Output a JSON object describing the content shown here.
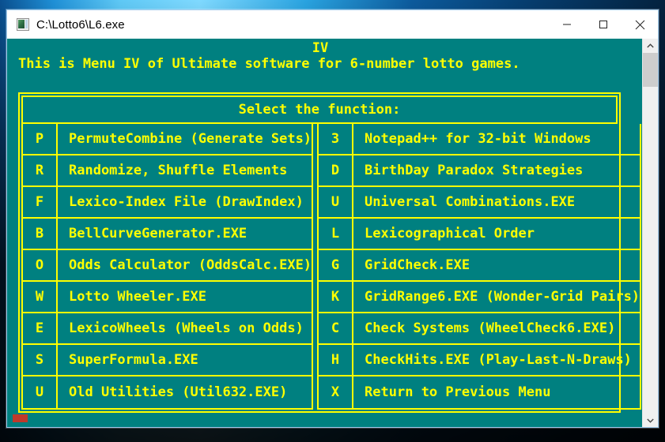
{
  "window": {
    "title": "C:\\Lotto6\\L6.exe",
    "icon": "console-app-icon",
    "minimize_label": "—",
    "maximize_label": "□",
    "close_label": "✕",
    "colors": {
      "console_background": "#008080",
      "console_text": "#ffff00",
      "titlebar_background": "#ffffff",
      "titlebar_text": "#000000",
      "scrollbar_track": "#f0f0f0",
      "scrollbar_thumb": "#cdcdcd",
      "desktop_accent": "#29a3e0",
      "marker": "#c0392b"
    }
  },
  "console": {
    "header_center": "IV",
    "header_line": "This is Menu IV of Ultimate software for 6-number lotto games.",
    "prompt": "Select the function:",
    "scrollbar": {
      "up_arrow": "⌃",
      "down_arrow": "⌄"
    }
  },
  "menu": {
    "left_column": [
      {
        "key": "P",
        "label": "PermuteCombine (Generate Sets)"
      },
      {
        "key": "R",
        "label": "Randomize, Shuffle Elements"
      },
      {
        "key": "F",
        "label": "Lexico-Index File (DrawIndex)"
      },
      {
        "key": "B",
        "label": "BellCurveGenerator.EXE"
      },
      {
        "key": "O",
        "label": "Odds Calculator (OddsCalc.EXE)"
      },
      {
        "key": "W",
        "label": "Lotto Wheeler.EXE"
      },
      {
        "key": "E",
        "label": "LexicoWheels (Wheels on Odds)"
      },
      {
        "key": "S",
        "label": "SuperFormula.EXE"
      },
      {
        "key": "U",
        "label": "Old Utilities (Util632.EXE)"
      }
    ],
    "right_column": [
      {
        "key": "3",
        "label": "Notepad++ for 32-bit Windows"
      },
      {
        "key": "D",
        "label": "BirthDay Paradox Strategies"
      },
      {
        "key": "U",
        "label": "Universal Combinations.EXE"
      },
      {
        "key": "L",
        "label": "Lexicographical Order"
      },
      {
        "key": "G",
        "label": "GridCheck.EXE"
      },
      {
        "key": "K",
        "label": "GridRange6.EXE (Wonder-Grid Pairs)"
      },
      {
        "key": "C",
        "label": "Check Systems (WheelCheck6.EXE)"
      },
      {
        "key": "H",
        "label": "CheckHits.EXE (Play-Last-N-Draws)"
      },
      {
        "key": "X",
        "label": "Return to Previous Menu"
      }
    ]
  }
}
